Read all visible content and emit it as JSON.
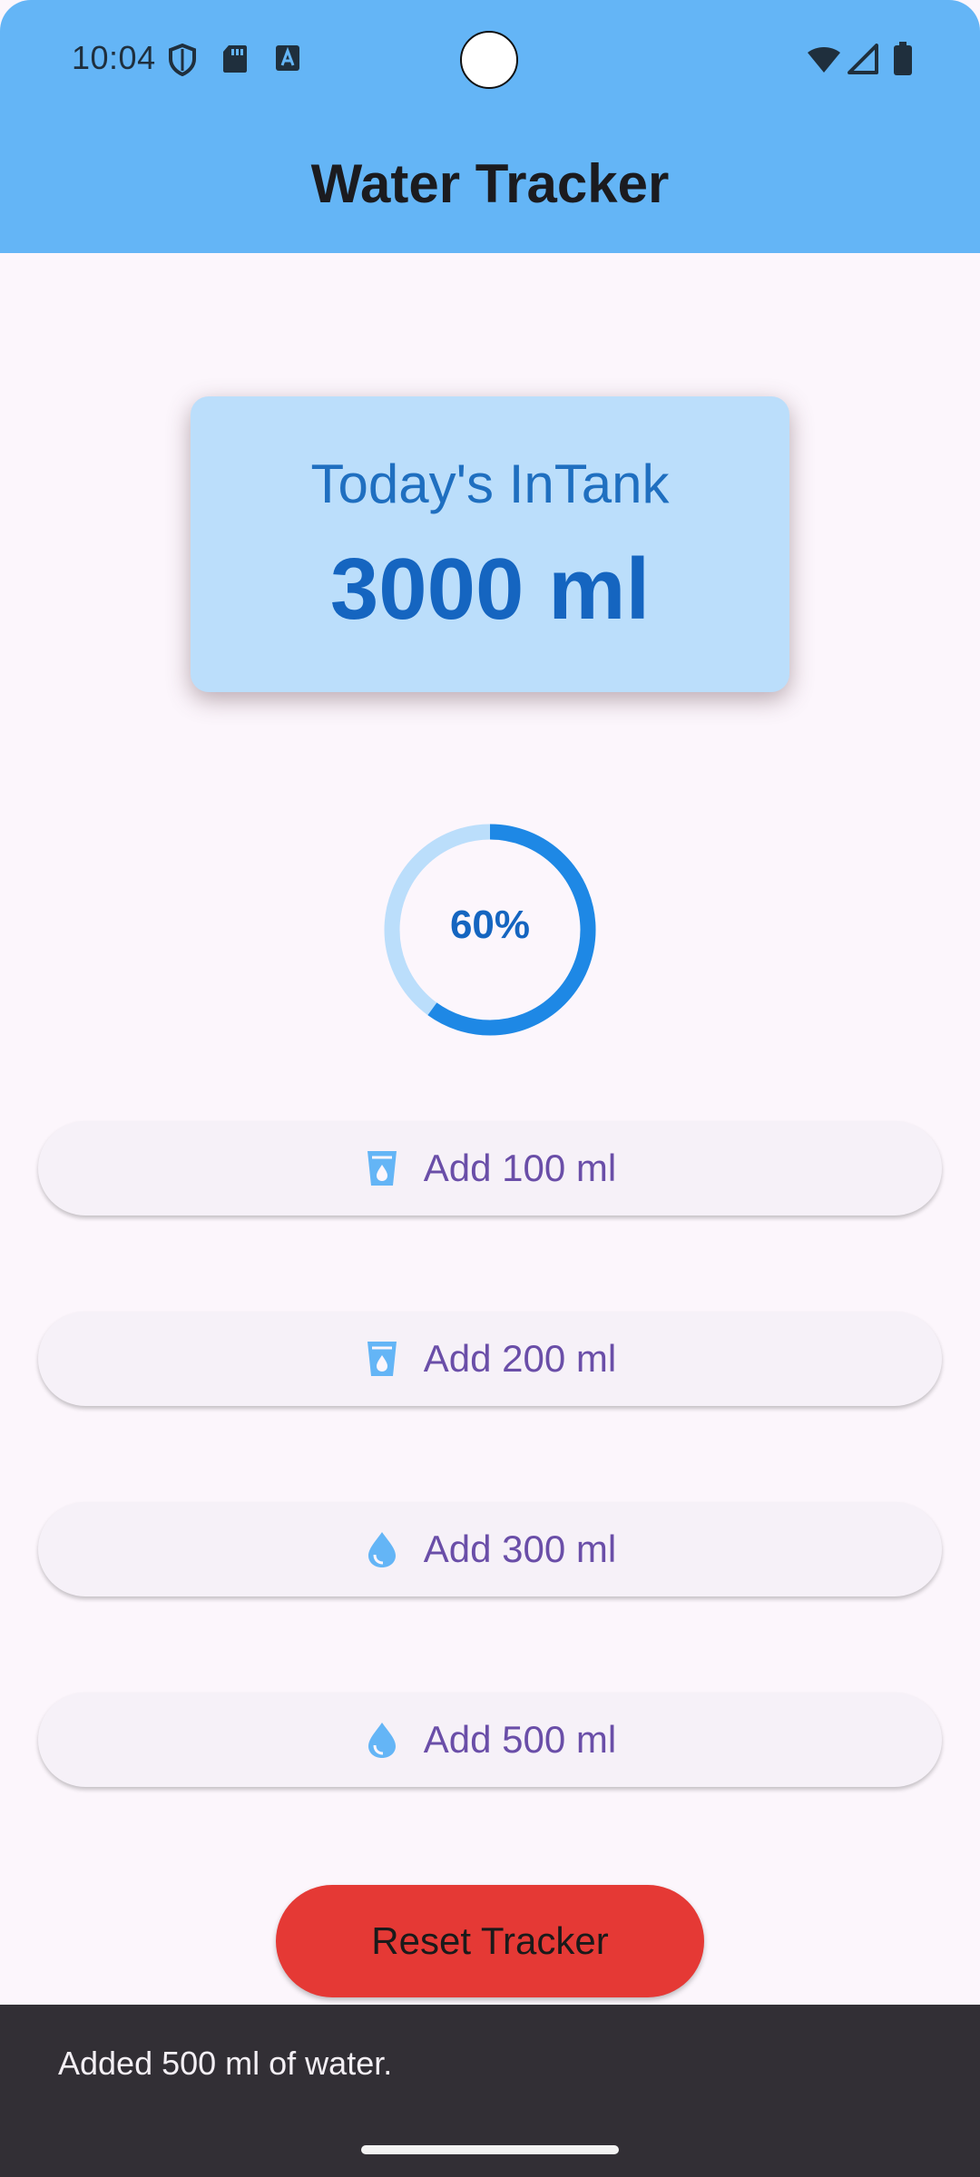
{
  "status_bar": {
    "time": "10:04",
    "icons_left": [
      "shield-icon",
      "sd-card-icon",
      "text-a-icon"
    ],
    "icons_right": [
      "wifi-icon",
      "signal-icon",
      "battery-icon"
    ]
  },
  "app_bar": {
    "title": "Water Tracker"
  },
  "intake": {
    "label": "Today's InTank",
    "value": "3000 ml"
  },
  "progress": {
    "fraction": 0.6,
    "text": "60%"
  },
  "buttons": [
    {
      "label": "Add 100 ml",
      "icon": "cup-icon"
    },
    {
      "label": "Add 200 ml",
      "icon": "cup-icon"
    },
    {
      "label": "Add 300 ml",
      "icon": "water-drop-icon"
    },
    {
      "label": "Add 500 ml",
      "icon": "water-drop-icon"
    }
  ],
  "reset": {
    "label": "Reset Tracker"
  },
  "snackbar": {
    "message": "Added 500 ml of water."
  },
  "colors": {
    "app_bar": "#64b5f6",
    "card": "#bbdefb",
    "accent": "#1e88e5",
    "ring_track": "#bbdefb",
    "button_text": "#6a4ea8",
    "reset": "#e53935",
    "snackbar": "#322f35"
  }
}
